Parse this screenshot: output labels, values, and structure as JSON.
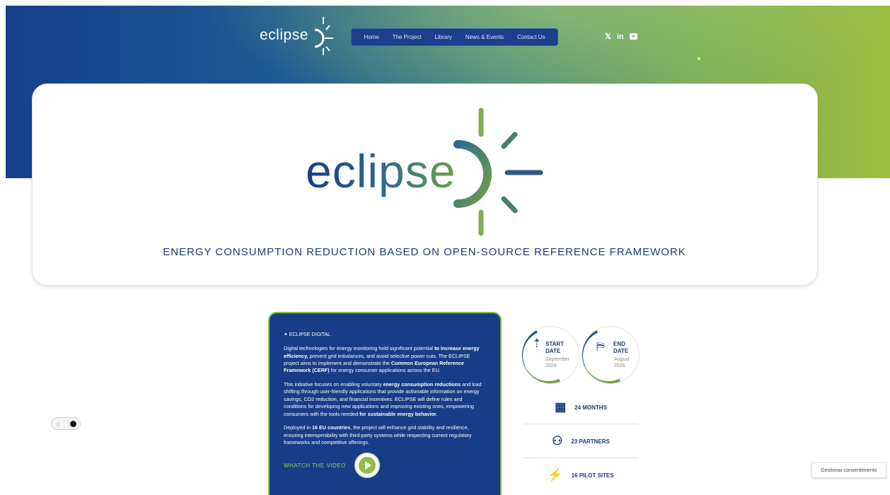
{
  "header": {
    "logo_text": "eclipse",
    "nav": [
      {
        "label": "Home"
      },
      {
        "label": "The Project"
      },
      {
        "label": "Library"
      },
      {
        "label": "News & Events"
      },
      {
        "label": "Contact Us"
      }
    ],
    "social": [
      {
        "icon": "x-icon",
        "label": "𝕏"
      },
      {
        "icon": "linkedin-icon",
        "label": "in"
      },
      {
        "icon": "youtube-icon",
        "label": ""
      }
    ]
  },
  "hero": {
    "logo_text": "eclipse",
    "tagline": "ENERGY CONSUMPTION REDUCTION BASED ON OPEN-SOURCE REFERENCE FRAMEWORK"
  },
  "theme_toggle": {
    "icon": "sun-icon"
  },
  "info": {
    "eyebrow": "✦ ECLIPSE DIGITAL",
    "p1_a": "Digital technologies for energy monitoring hold significant potential ",
    "p1_b": "to increase energy efficiency,",
    "p1_c": " prevent grid imbalances, and avoid selective power cuts. The ECLIPSE project aims to implement and demonstrate the ",
    "p1_d": "Common European Reference Framework (CERF)",
    "p1_e": " for energy consumer applications across the EU.",
    "p2_a": "This initiative focuses on enabling voluntary ",
    "p2_b": "energy consumption reductions",
    "p2_c": " and load shifting through user-friendly applications that provide actionable information on energy savings, CO2 reduction, and financial incentives. ECLIPSE will define rules and conditions for developing new applications and improving existing ones, empowering consumers with the tools needed ",
    "p2_d": "for sustainable energy behavior",
    "p2_e": ".",
    "p3_a": "Deployed in ",
    "p3_b": "16 EU countries",
    "p3_c": ", the project will enhance grid stability and resilience, ensuring interoperability with third-party systems while respecting current regulatory frameworks and competitive offerings.",
    "video_label": "WHATCH THE VIDEO"
  },
  "dates": {
    "start": {
      "title_1": "START",
      "title_2": "DATE",
      "month": "September",
      "year": "2024",
      "icon": "rocket-icon"
    },
    "end": {
      "title_1": "END",
      "title_2": "DATE",
      "month": "August",
      "year": "2026",
      "icon": "finish-line-icon"
    }
  },
  "stats": [
    {
      "icon": "calendar-icon",
      "label": "24 MONTHS"
    },
    {
      "icon": "partners-icon",
      "label": "23 PARTNERS"
    },
    {
      "icon": "pilot-sites-icon",
      "label": "16 PILOT SITES"
    }
  ],
  "consent": {
    "label": "Gestionar consentimiento"
  }
}
